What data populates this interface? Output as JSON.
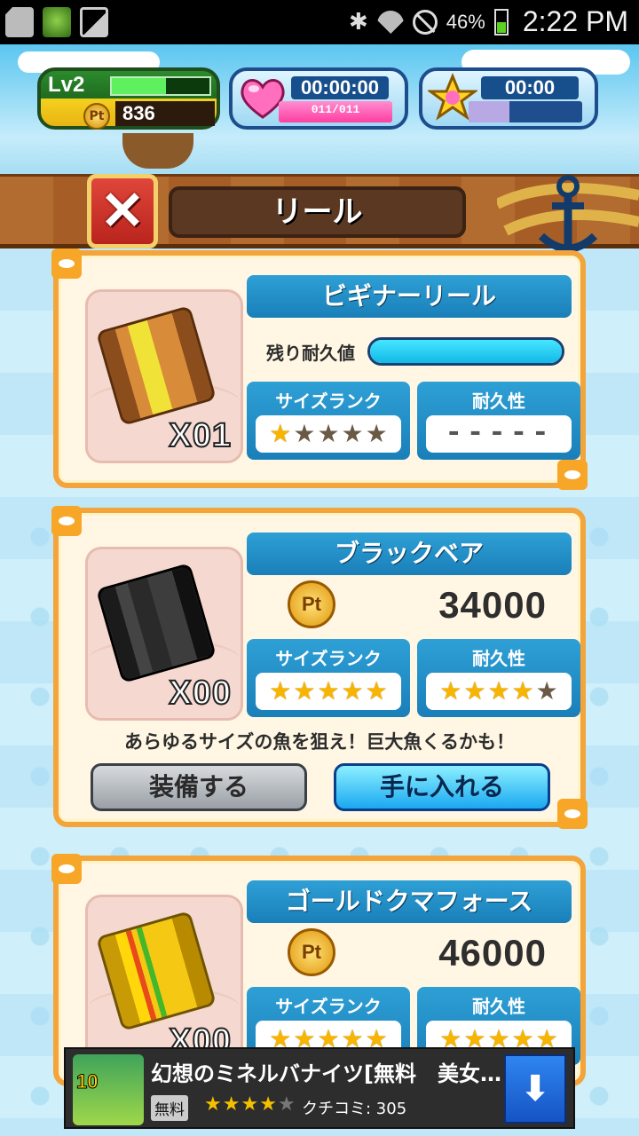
{
  "status_bar": {
    "battery_pct": "46%",
    "time": "2:22 PM",
    "icons": [
      "sd-card-icon",
      "game-icon",
      "image-icon",
      "bluetooth-icon",
      "wifi-icon",
      "no-signal-icon",
      "battery-icon"
    ]
  },
  "hud": {
    "level": "Lv2",
    "level_progress": 0.55,
    "pt_label": "Pt",
    "points": "836",
    "heart_timer": "00:00:00",
    "heart_count": "011/011",
    "star_timer": "00:00",
    "star_progress": 0.36
  },
  "title": {
    "close_label": "✕",
    "text": "リール"
  },
  "reels": [
    {
      "name": "ビギナーリール",
      "count": "X01",
      "durability_label": "残り耐久値",
      "durability_remaining": 1.0,
      "size_rank_label": "サイズランク",
      "size_rank": 1,
      "size_rank_max": 5,
      "durability_rank_label": "耐久性",
      "durability_rank_text": "-----"
    },
    {
      "name": "ブラックベア",
      "count": "X00",
      "pt_label": "Pt",
      "price": "34000",
      "size_rank_label": "サイズランク",
      "size_rank": 5,
      "size_rank_max": 5,
      "durability_rank_label": "耐久性",
      "durability_rank": 4,
      "durability_rank_max": 5,
      "description": "あらゆるサイズの魚を狙え！巨大魚くるかも！",
      "equip_label": "装備する",
      "get_label": "手に入れる"
    },
    {
      "name": "ゴールドクマフォース",
      "count": "X00",
      "pt_label": "Pt",
      "price": "46000",
      "size_rank_label": "サイズランク",
      "size_rank": 5,
      "size_rank_max": 5,
      "durability_rank_label": "耐久性",
      "durability_rank": 5,
      "durability_rank_max": 5
    }
  ],
  "ad": {
    "icon_text": "10",
    "title": "幻想のミネルバナイツ[無料　美女…",
    "free_label": "無料",
    "rating": 4,
    "rating_max": 5,
    "review_text": "クチコミ: 305",
    "download_icon": "download-arrow-icon"
  }
}
